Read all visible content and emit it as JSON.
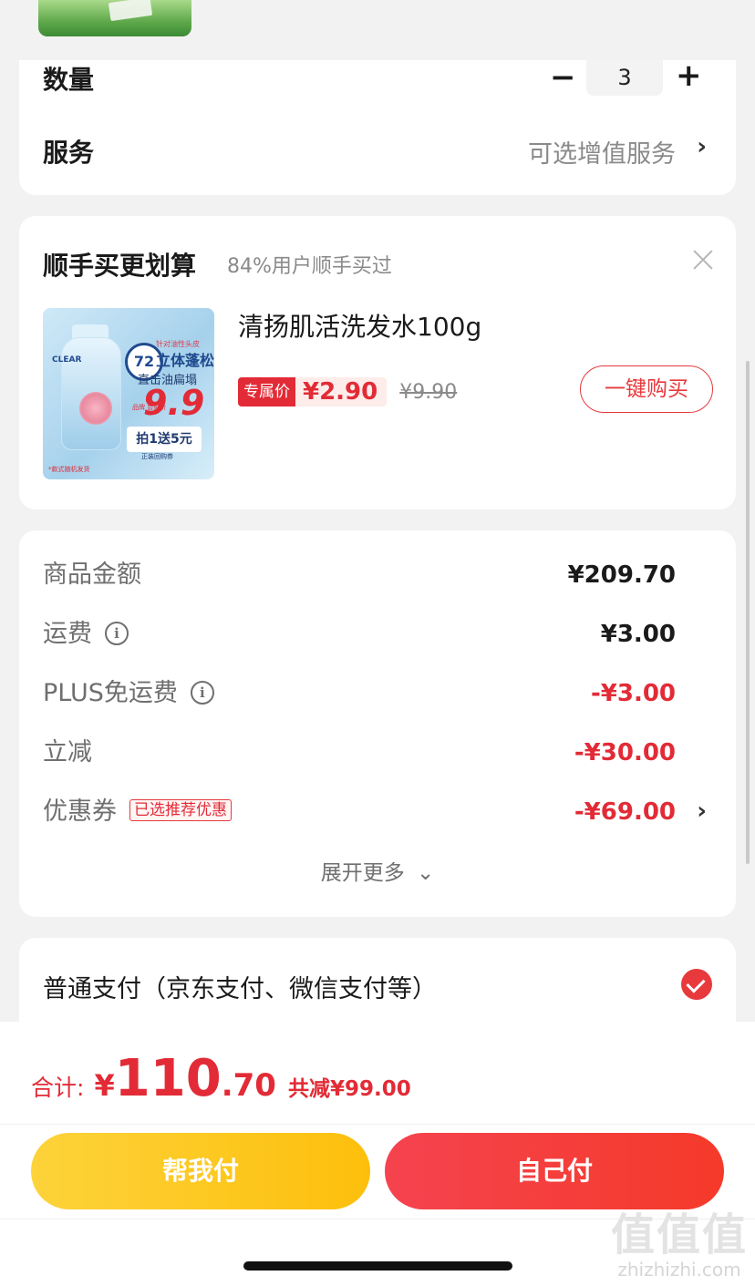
{
  "quantity": {
    "label": "数量",
    "value": "3",
    "minus": "−",
    "plus": "+"
  },
  "service": {
    "label": "服务",
    "value": "可选增值服务",
    "chevron": "›"
  },
  "addon": {
    "title": "顺手买更划算",
    "subtitle": "84%用户顺手买过",
    "product": {
      "name": "清扬肌活洗发水100g",
      "exclusive_tag": "专属价",
      "price": "¥2.90",
      "original_price": "¥9.90",
      "buy_label": "一键购买",
      "image": {
        "brand": "CLEAR",
        "badge": "72",
        "top_tag": "针对油性头皮",
        "headline": "立体蓬松",
        "subline": "直击油扁塌",
        "price": "9.9",
        "brand_tag": "品牌 尝鲜价",
        "promo": "拍1送5元",
        "promo_sub": "正装回购券",
        "footer": "*款式随机发货"
      }
    }
  },
  "summary": {
    "rows": [
      {
        "label": "商品金额",
        "value": "¥209.70",
        "red": false,
        "info": false
      },
      {
        "label": "运费",
        "value": "¥3.00",
        "red": false,
        "info": true
      },
      {
        "label": "PLUS免运费",
        "value": "-¥3.00",
        "red": true,
        "info": true
      },
      {
        "label": "立减",
        "value": "-¥30.00",
        "red": true,
        "info": false
      },
      {
        "label": "优惠券",
        "value": "-¥69.00",
        "red": true,
        "info": false,
        "tag": "已选推荐优惠"
      }
    ],
    "info_glyph": "i",
    "expand_label": "展开更多",
    "expand_chevron": "⌄",
    "chevron": "›"
  },
  "payment": {
    "label": "普通支付（京东支付、微信支付等）"
  },
  "footer": {
    "total_label": "合计:",
    "currency": "¥",
    "total_int": "110",
    "total_dec": ".70",
    "savings": "共减¥99.00",
    "help_pay": "帮我付",
    "self_pay": "自己付"
  },
  "watermark": {
    "logo": "值值值",
    "url": "zhizhizhi.com"
  },
  "colors": {
    "accent_red": "#e22b36",
    "button_yellow": "#fdc92a",
    "button_red": "#f53f42",
    "background": "#f2f2f2"
  }
}
